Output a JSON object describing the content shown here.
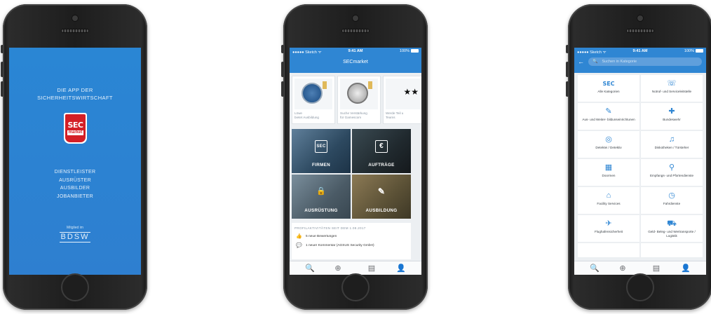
{
  "splash": {
    "head_line1": "DIE APP DER",
    "head_line2": "SICHERHEITSWIRTSCHAFT",
    "logo_sec": "SEC",
    "logo_market": "market",
    "roles": [
      "DIENSTLEISTER",
      "AUSRÜSTER",
      "AUSBILDER",
      "JOBANBIETER"
    ],
    "member_label": "Mitglied im",
    "bdsw": "BDSW"
  },
  "status": {
    "carrier": "●●●●● Sketch ᯤ",
    "time": "9:41 AM",
    "battery": "100%"
  },
  "dashboard": {
    "title": "SECmarket",
    "cards": [
      {
        "line1": "Löwe",
        "line2": "bietet Ausbildung"
      },
      {
        "line1": "Suche Verstärkung",
        "line2": "für Gamescom"
      },
      {
        "line1": "Werde Teil u",
        "line2": "Teams"
      }
    ],
    "tiles": [
      {
        "label": "FIRMEN",
        "icon": "SEC"
      },
      {
        "label": "AUFTRÄGE",
        "icon": "€"
      },
      {
        "label": "AUSRÜSTUNG",
        "icon": "🔒"
      },
      {
        "label": "AUSBILDUNG",
        "icon": "✎"
      }
    ],
    "activity_header": "PROFILAKTIVITÄTEN SEIT DEM 1.08.2017",
    "activity": [
      {
        "icon": "thumbs-up-icon",
        "glyph": "👍",
        "text": "5 neue Bewertungen"
      },
      {
        "icon": "comment-icon",
        "glyph": "💬",
        "text": "1 neuer Kommentar (AGSUS Security GmbH)"
      }
    ]
  },
  "tabbar": {
    "search": "🔍",
    "add": "⊕",
    "news": "▤",
    "profile": "👤"
  },
  "categories": {
    "search_placeholder": "Suchen in Kategorie",
    "items": [
      {
        "label": "Alle Kategorien",
        "icon": "SEC"
      },
      {
        "label": "Notruf- und Serviceleitstelle",
        "icon": "☏"
      },
      {
        "label": "Aus- und Weiter- bildunseinrichtunen",
        "icon": "✎"
      },
      {
        "label": "Bundeswehr",
        "icon": "✚"
      },
      {
        "label": "Detektei / Detektiv",
        "icon": "◎"
      },
      {
        "label": "Diskotheken / Türsteher",
        "icon": "♫"
      },
      {
        "label": "Doormen",
        "icon": "▦"
      },
      {
        "label": "Empfangs- und Pfortendienste",
        "icon": "⚲"
      },
      {
        "label": "Facility Services",
        "icon": "⌂"
      },
      {
        "label": "Fahrdienste",
        "icon": "◷"
      },
      {
        "label": "Flughafensicherheit",
        "icon": "✈"
      },
      {
        "label": "Geld- Beleg- und Wertransporte / Logistik",
        "icon": "⛟"
      }
    ]
  }
}
